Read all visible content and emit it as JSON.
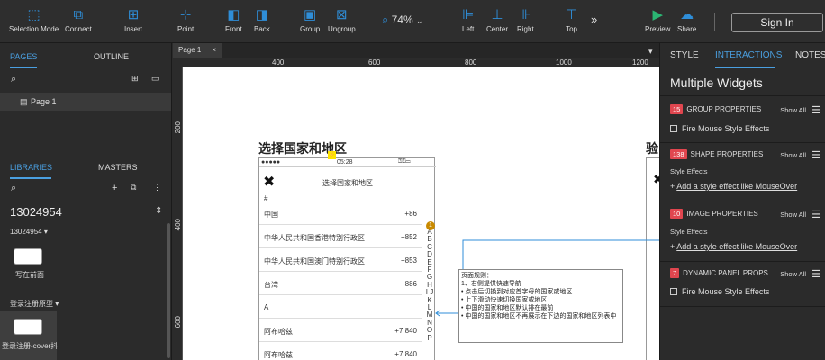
{
  "toolbar": {
    "selection_mode": "Selection Mode",
    "connect": "Connect",
    "insert": "Insert",
    "point": "Point",
    "front": "Front",
    "back": "Back",
    "group": "Group",
    "ungroup": "Ungroup",
    "zoom": "74%",
    "left": "Left",
    "center": "Center",
    "right": "Right",
    "top": "Top",
    "more": "»",
    "preview": "Preview",
    "share": "Share",
    "signin": "Sign In",
    "accent": "#2f8ed8"
  },
  "left_panel": {
    "tabs": {
      "pages": "PAGES",
      "outline": "OUTLINE"
    },
    "page_item": "Page 1",
    "lib_tabs": {
      "libraries": "LIBRARIES",
      "masters": "MASTERS"
    },
    "library_name": "13024954",
    "folder1": "13024954 ▾",
    "item1": "写在前面",
    "folder2": "登录注册原型 ▾",
    "item2": "登录注册-cover抖"
  },
  "canvas": {
    "page_tab": "Page 1",
    "close": "×",
    "ruler_h": [
      "400",
      "600",
      "800",
      "1000",
      "1200"
    ],
    "ruler_v": [
      "200",
      "400",
      "600"
    ],
    "title": "选择国家和地区",
    "title2": "验",
    "status_time": "05:28",
    "status_dots": "●●●●●",
    "close_icon": "✖",
    "header": "选择国家和地区",
    "hash": "#",
    "rows": [
      {
        "name": "中国",
        "code": "+86"
      },
      {
        "name": "中华人民共和国香港特别行政区",
        "code": "+852"
      },
      {
        "name": "中华人民共和国澳门特别行政区",
        "code": "+853"
      },
      {
        "name": "台湾",
        "code": "+886"
      },
      {
        "name": "A",
        "code": ""
      },
      {
        "name": "阿布哈兹",
        "code": "+7 840"
      },
      {
        "name": "阿布哈兹",
        "code": "+7 840"
      }
    ],
    "alpha": "A B C D E F G H I J K L M N O P",
    "marker": "1",
    "note_lines": [
      "页面规则：",
      "1、右侧提供快速导航",
      "• 点击后切换到对应首字母的国家或地区",
      "• 上下滑动快速切换国家或地区",
      "• 中国的国家和地区默认排在最前",
      "• 中国的国家和地区不再展示在下边的国家和地区列表中"
    ]
  },
  "right_panel": {
    "tabs": {
      "style": "STYLE",
      "interactions": "INTERACTIONS",
      "notes": "NOTES"
    },
    "title": "Multiple Widgets",
    "sections": [
      {
        "badge": "15",
        "label": "GROUP PROPERTIES",
        "show": "Show All",
        "item": "Fire Mouse Style Effects"
      },
      {
        "badge": "138",
        "label": "SHAPE PROPERTIES",
        "show": "Show All",
        "sub": "Style Effects",
        "link": "Add a style effect like MouseOver"
      },
      {
        "badge": "10",
        "label": "IMAGE PROPERTIES",
        "show": "Show All",
        "sub": "Style Effects",
        "link": "Add a style effect like MouseOver"
      },
      {
        "badge": "7",
        "label": "DYNAMIC PANEL PROPS",
        "show": "Show All",
        "item": "Fire Mouse Style Effects"
      }
    ]
  }
}
